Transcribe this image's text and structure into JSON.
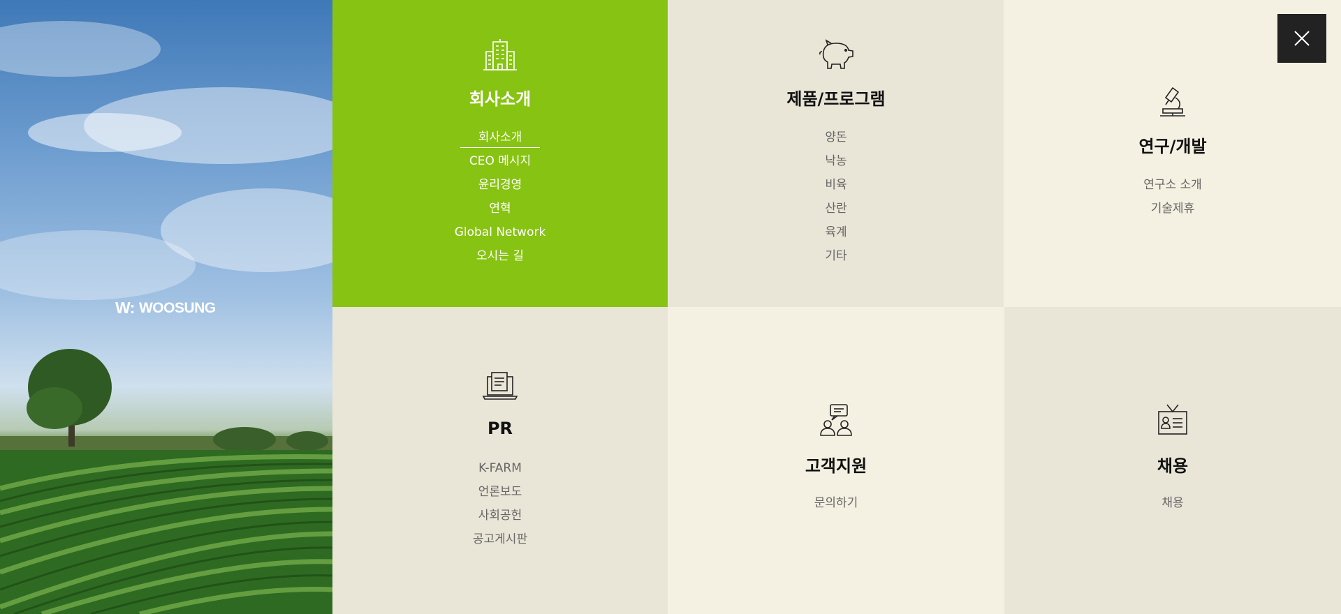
{
  "brand": {
    "logo_text": "WOOSUNG",
    "logo_mark": "W:"
  },
  "close_button": {
    "label": "close",
    "icon": "close-icon"
  },
  "menu": [
    {
      "key": "company",
      "title": "회사소개",
      "icon": "building-icon",
      "items": [
        "회사소개",
        "CEO 메시지",
        "윤리경영",
        "연혁",
        "Global Network",
        "오시는 길"
      ],
      "active_item": "회사소개"
    },
    {
      "key": "products",
      "title": "제품/프로그램",
      "icon": "pig-icon",
      "items": [
        "양돈",
        "낙농",
        "비육",
        "산란",
        "육계",
        "기타"
      ]
    },
    {
      "key": "research",
      "title": "연구/개발",
      "icon": "microscope-icon",
      "items": [
        "연구소 소개",
        "기술제휴"
      ]
    },
    {
      "key": "pr",
      "title": "PR",
      "icon": "laptop-document-icon",
      "items": [
        "K-FARM",
        "언론보도",
        "사회공헌",
        "공고게시판"
      ]
    },
    {
      "key": "support",
      "title": "고객지원",
      "icon": "consultation-icon",
      "items": [
        "문의하기"
      ]
    },
    {
      "key": "recruit",
      "title": "채용",
      "icon": "id-card-icon",
      "items": [
        "채용"
      ]
    }
  ],
  "colors": {
    "active_tile": "#87c312",
    "tile_beige": "#e9e5d7",
    "tile_cream": "#f4f1e2",
    "close_bg": "#222222"
  }
}
